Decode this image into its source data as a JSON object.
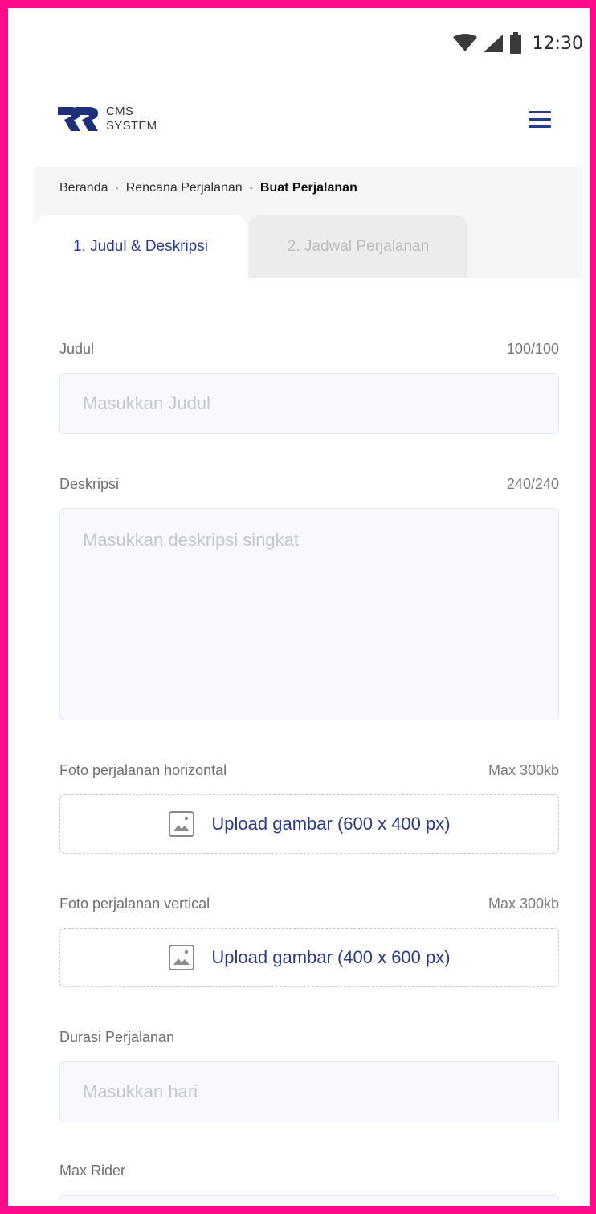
{
  "status": {
    "time": "12:30"
  },
  "header": {
    "logo_line1": "CMS",
    "logo_line2": "SYSTEM"
  },
  "breadcrumb": {
    "items": [
      "Beranda",
      "Rencana Perjalanan"
    ],
    "current": "Buat Perjalanan"
  },
  "tabs": [
    {
      "label": "1. Judul & Deskripsi",
      "active": true
    },
    {
      "label": "2. Jadwal Perjalanan",
      "active": false
    }
  ],
  "form": {
    "title": {
      "label": "Judul",
      "counter": "100/100",
      "placeholder": "Masukkan Judul",
      "value": ""
    },
    "description": {
      "label": "Deskripsi",
      "counter": "240/240",
      "placeholder": "Masukkan deskripsi singkat",
      "value": ""
    },
    "photo_horizontal": {
      "label": "Foto perjalanan horizontal",
      "limit": "Max 300kb",
      "button": "Upload gambar (600 x 400 px)"
    },
    "photo_vertical": {
      "label": "Foto perjalanan vertical",
      "limit": "Max 300kb",
      "button": "Upload gambar (400 x 600 px)"
    },
    "duration": {
      "label": "Durasi Perjalanan",
      "placeholder": "Masukkan hari",
      "value": ""
    },
    "max_rider": {
      "label": "Max Rider",
      "placeholder": "",
      "value": ""
    }
  },
  "colors": {
    "accent": "#2a3c8a",
    "frame": "#ff0a8c",
    "input_bg": "#f7f9ff"
  }
}
